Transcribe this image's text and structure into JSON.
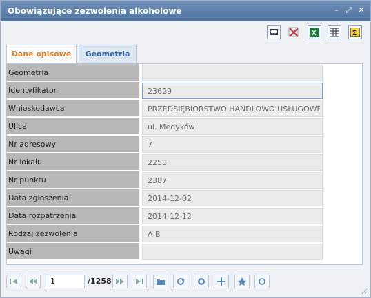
{
  "window": {
    "title": "Obowiązujące zezwolenia alkoholowe",
    "controls": [
      "minimize-icon",
      "maximize-icon",
      "close-icon"
    ]
  },
  "toolbar": {
    "tools": [
      "search-icon",
      "clear-filter-icon",
      "excel-icon",
      "table-icon",
      "sum-icon"
    ]
  },
  "tabs": [
    {
      "label": "Dane opisowe",
      "active": true
    },
    {
      "label": "Geometria",
      "active": false
    }
  ],
  "fields": [
    {
      "label": "Geometria",
      "value": ""
    },
    {
      "label": "Identyfikator",
      "value": "23629"
    },
    {
      "label": "Wnioskodawca",
      "value": "PRZEDSIĘBIORSTWO HANDLOWO USŁUGOWE \"BEM"
    },
    {
      "label": "Ulica",
      "value": "ul. Medyków"
    },
    {
      "label": "Nr adresowy",
      "value": "7"
    },
    {
      "label": "Nr lokalu",
      "value": "2258"
    },
    {
      "label": "Nr punktu",
      "value": "2387"
    },
    {
      "label": "Data zgłoszenia",
      "value": "2014-12-02"
    },
    {
      "label": "Data rozpatrzenia",
      "value": "2014-12-12"
    },
    {
      "label": "Rodzaj zezwolenia",
      "value": "A,B"
    },
    {
      "label": "Uwagi",
      "value": ""
    }
  ],
  "pager": {
    "current": "1",
    "total": "/1258"
  }
}
